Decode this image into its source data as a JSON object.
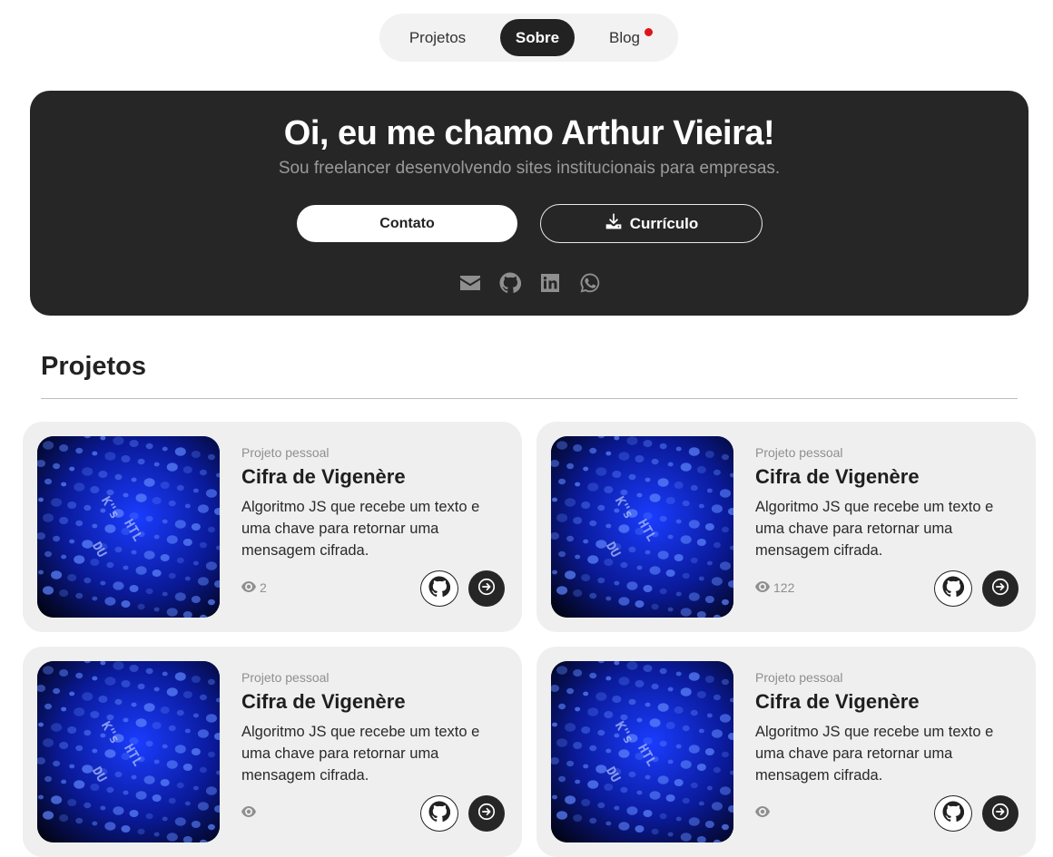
{
  "nav": {
    "items": [
      {
        "label": "Projetos"
      },
      {
        "label": "Sobre"
      },
      {
        "label": "Blog"
      }
    ],
    "active": "Sobre"
  },
  "hero": {
    "title": "Oi, eu me chamo Arthur Vieira!",
    "subtitle": "Sou freelancer desenvolvendo sites institucionais para empresas.",
    "contact_button": "Contato",
    "resume_button": "Currículo",
    "socials": [
      "envelope-icon",
      "github-icon",
      "linkedin-icon",
      "whatsapp-icon"
    ]
  },
  "projects": {
    "title": "Projetos",
    "cards": [
      {
        "tag": "Projeto pessoal",
        "title": "Cifra de Vigenère",
        "description": "Algoritmo JS que recebe um texto e uma chave para retornar uma mensagem cifrada.",
        "views": "2"
      },
      {
        "tag": "Projeto pessoal",
        "title": "Cifra de Vigenère",
        "description": "Algoritmo JS que recebe um texto e uma chave para retornar uma mensagem cifrada.",
        "views": "122"
      },
      {
        "tag": "Projeto pessoal",
        "title": "Cifra de Vigenère",
        "description": "Algoritmo JS que recebe um texto e uma chave para retornar uma mensagem cifrada.",
        "views": ""
      },
      {
        "tag": "Projeto pessoal",
        "title": "Cifra de Vigenère",
        "description": "Algoritmo JS que recebe um texto e uma chave para retornar uma mensagem cifrada.",
        "views": ""
      }
    ]
  },
  "colors": {
    "dark": "#262626",
    "card_bg": "#efefef",
    "notification_dot": "#e0131b",
    "muted_text": "#8f8f8f"
  }
}
